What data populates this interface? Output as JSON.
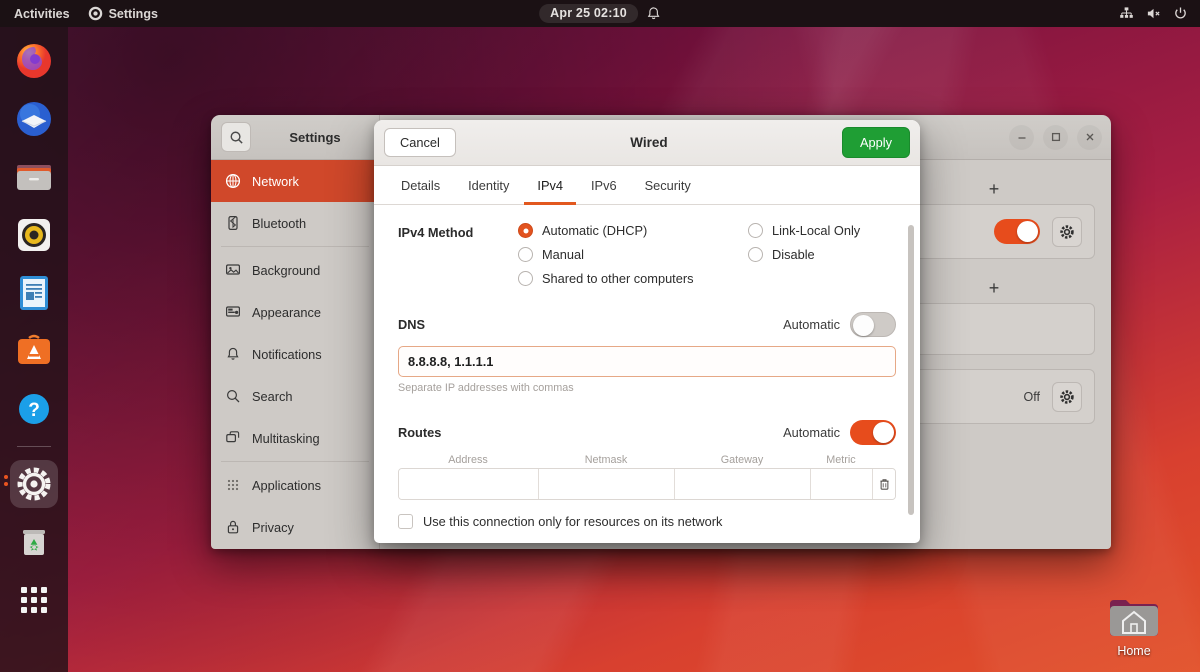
{
  "topbar": {
    "activities": "Activities",
    "app_name": "Settings",
    "app_icon": "gear-icon",
    "clock": "Apr 25  02:10",
    "bell_icon": "bell-icon",
    "indicators": [
      "wired-network-icon",
      "volume-muted-icon",
      "power-icon"
    ]
  },
  "dock": {
    "items": [
      {
        "name": "firefox",
        "label": "Firefox"
      },
      {
        "name": "thunderbird",
        "label": "Thunderbird"
      },
      {
        "name": "files",
        "label": "Files"
      },
      {
        "name": "rhythmbox",
        "label": "Rhythmbox"
      },
      {
        "name": "libreoffice-writer",
        "label": "LibreOffice Writer"
      },
      {
        "name": "ubuntu-software",
        "label": "Ubuntu Software"
      },
      {
        "name": "help",
        "label": "Help"
      },
      {
        "name": "settings",
        "label": "Settings"
      },
      {
        "name": "trash",
        "label": "Trash"
      },
      {
        "name": "show-applications",
        "label": "Show Applications"
      }
    ]
  },
  "desktop": {
    "home_folder_label": "Home"
  },
  "settings_window": {
    "title": "Settings",
    "search_icon": "search-icon",
    "window_controls": [
      "minimize",
      "maximize",
      "close"
    ],
    "sidebar": [
      {
        "label": "Network",
        "icon": "network-icon",
        "selected": true
      },
      {
        "label": "Bluetooth",
        "icon": "bluetooth-icon",
        "selected": false
      },
      {
        "label": "Background",
        "icon": "background-icon",
        "selected": false
      },
      {
        "label": "Appearance",
        "icon": "appearance-icon",
        "selected": false
      },
      {
        "label": "Notifications",
        "icon": "bell-icon",
        "selected": false
      },
      {
        "label": "Search",
        "icon": "search-icon",
        "selected": false
      },
      {
        "label": "Multitasking",
        "icon": "multitasking-icon",
        "selected": false
      },
      {
        "label": "Applications",
        "icon": "grid-icon",
        "selected": false
      },
      {
        "label": "Privacy",
        "icon": "lock-icon",
        "selected": false
      }
    ],
    "content": {
      "add_button_label": "+",
      "wired_toggle_state": "on",
      "vpn_off_label": "Off"
    }
  },
  "dialog": {
    "title": "Wired",
    "cancel_label": "Cancel",
    "apply_label": "Apply",
    "tabs": [
      {
        "label": "Details",
        "active": false
      },
      {
        "label": "Identity",
        "active": false
      },
      {
        "label": "IPv4",
        "active": true
      },
      {
        "label": "IPv6",
        "active": false
      },
      {
        "label": "Security",
        "active": false
      }
    ],
    "ipv4_method": {
      "label": "IPv4 Method",
      "options_left": [
        {
          "label": "Automatic (DHCP)",
          "checked": true
        },
        {
          "label": "Manual",
          "checked": false
        },
        {
          "label": "Shared to other computers",
          "checked": false
        }
      ],
      "options_right": [
        {
          "label": "Link-Local Only",
          "checked": false
        },
        {
          "label": "Disable",
          "checked": false
        }
      ]
    },
    "dns": {
      "title": "DNS",
      "automatic_label": "Automatic",
      "automatic_state": "off",
      "value": "8.8.8.8, 1.1.1.1",
      "hint": "Separate IP addresses with commas"
    },
    "routes": {
      "title": "Routes",
      "automatic_label": "Automatic",
      "automatic_state": "on",
      "columns": [
        "Address",
        "Netmask",
        "Gateway",
        "Metric"
      ],
      "rows": [
        {
          "address": "",
          "netmask": "",
          "gateway": "",
          "metric": ""
        }
      ],
      "delete_icon": "trash-icon"
    },
    "restrict_checkbox": {
      "label": "Use this connection only for resources on its network",
      "checked": false
    }
  },
  "colors": {
    "ubuntu_orange": "#e95420",
    "apply_green": "#1f9e34",
    "selected_sidebar": "#d0482a",
    "focus_border": "#e6a886"
  }
}
